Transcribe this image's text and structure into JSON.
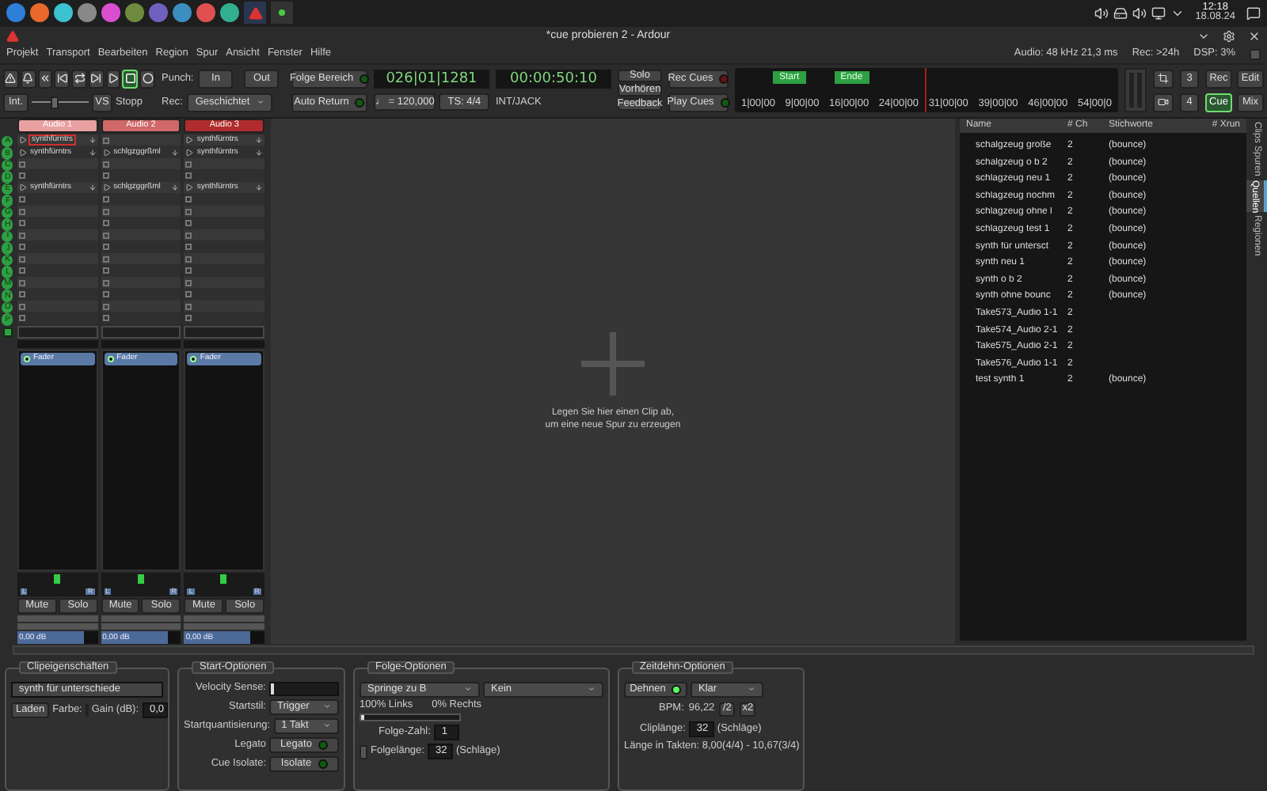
{
  "taskbar": {
    "time": "12:18",
    "date": "18.08.24"
  },
  "window": {
    "title": "*cue probieren 2 - Ardour"
  },
  "menu": [
    "Projekt",
    "Transport",
    "Bearbeiten",
    "Region",
    "Spur",
    "Ansicht",
    "Fenster",
    "Hilfe"
  ],
  "status": [
    "Audio: 48 kHz 21,3 ms",
    "Rec: >24h",
    "DSP: 3%"
  ],
  "transport": [
    {
      "kind": "panic",
      "on": false
    },
    {
      "kind": "metronome",
      "on": false
    },
    {
      "kind": "start",
      "on": false
    },
    {
      "kind": "prev",
      "on": false
    },
    {
      "kind": "loop",
      "on": false
    },
    {
      "kind": "end",
      "on": false
    },
    {
      "kind": "play",
      "on": false
    },
    {
      "kind": "stop",
      "on": true
    },
    {
      "kind": "record",
      "on": false
    }
  ],
  "shuttle": {
    "mode": "Int.",
    "level": 0.4,
    "vs": "VS",
    "state": "Stopp"
  },
  "punch": {
    "label": "Punch:",
    "in": "In",
    "out": "Out"
  },
  "rec": {
    "label": "Rec:",
    "mode": "Geschichtet"
  },
  "toggles": [
    {
      "label": "Folge Bereich",
      "on": false
    },
    {
      "label": "Auto Return",
      "on": false
    }
  ],
  "clock1": {
    "value": "026|01|1281",
    "tempo": "♩ = 120,000",
    "meter": "TS: 4/4"
  },
  "clock2": {
    "value": "00:00:50:10",
    "sync": "INT/JACK"
  },
  "monitor": [
    "Solo",
    "Vorhören",
    "Feedback"
  ],
  "cue_buttons": [
    {
      "label": "Rec Cues",
      "kind": "rec",
      "on": false
    },
    {
      "label": "Play Cues",
      "kind": "play",
      "on": false
    }
  ],
  "mini_timeline": {
    "markers": [
      "Start",
      "Ende"
    ],
    "ticks": [
      "1|00|00",
      "9|00|00",
      "16|00|00",
      "24|00|00",
      "31|00|00",
      "39|00|00",
      "46|00|00",
      "54|00|0"
    ]
  },
  "numbers": [
    "3",
    "4"
  ],
  "views": [
    {
      "label": "Rec",
      "selected": false
    },
    {
      "label": "Edit",
      "selected": false
    },
    {
      "label": "Cue",
      "selected": true
    },
    {
      "label": "Mix",
      "selected": false
    }
  ],
  "cues": [
    "A",
    "B",
    "C",
    "D",
    "E",
    "F",
    "G",
    "H",
    "I",
    "J",
    "K",
    "L",
    "M",
    "N",
    "O",
    "P"
  ],
  "tracks": [
    {
      "name": "Audio 1",
      "color": "#e8a0a0",
      "plugin": "Fader",
      "pan_l": "L",
      "pan_r": "R",
      "mute": "Mute",
      "solo": "Solo",
      "gain": "0,00 dB",
      "slots": [
        {
          "kind": "clip",
          "label": "synthfürntrs",
          "selected": true
        },
        {
          "kind": "clip",
          "label": "synthfürntrs",
          "selected": false
        },
        {
          "kind": "empty",
          "selected": false
        },
        {
          "kind": "empty",
          "selected": false
        },
        {
          "kind": "clip",
          "label": "synthfürntrs",
          "selected": false
        },
        {
          "kind": "empty",
          "selected": false
        },
        {
          "kind": "empty",
          "selected": false
        },
        {
          "kind": "empty",
          "selected": false
        },
        {
          "kind": "empty",
          "selected": false
        },
        {
          "kind": "empty",
          "selected": false
        },
        {
          "kind": "empty",
          "selected": false
        },
        {
          "kind": "empty",
          "selected": false
        },
        {
          "kind": "empty",
          "selected": false
        },
        {
          "kind": "empty",
          "selected": false
        },
        {
          "kind": "empty",
          "selected": false
        },
        {
          "kind": "empty",
          "selected": false
        }
      ]
    },
    {
      "name": "Audio 2",
      "color": "#d06868",
      "plugin": "Fader",
      "pan_l": "L",
      "pan_r": "R",
      "mute": "Mute",
      "solo": "Solo",
      "gain": "0,00 dB",
      "slots": [
        {
          "kind": "empty",
          "selected": false
        },
        {
          "kind": "clip",
          "label": "schlgzggrßml",
          "selected": false
        },
        {
          "kind": "empty",
          "selected": false
        },
        {
          "kind": "empty",
          "selected": false
        },
        {
          "kind": "clip",
          "label": "schlgzggrßml",
          "selected": false
        },
        {
          "kind": "empty",
          "selected": false
        },
        {
          "kind": "empty",
          "selected": false
        },
        {
          "kind": "empty",
          "selected": false
        },
        {
          "kind": "empty",
          "selected": false
        },
        {
          "kind": "empty",
          "selected": false
        },
        {
          "kind": "empty",
          "selected": false
        },
        {
          "kind": "empty",
          "selected": false
        },
        {
          "kind": "empty",
          "selected": false
        },
        {
          "kind": "empty",
          "selected": false
        },
        {
          "kind": "empty",
          "selected": false
        },
        {
          "kind": "empty",
          "selected": false
        }
      ]
    },
    {
      "name": "Audio 3",
      "color": "#b02c2c",
      "plugin": "Fader",
      "pan_l": "L",
      "pan_r": "R",
      "mute": "Mute",
      "solo": "Solo",
      "gain": "0,00 dB",
      "slots": [
        {
          "kind": "clip",
          "label": "synthfürntrs",
          "selected": false
        },
        {
          "kind": "clip",
          "label": "synthfürntrs",
          "selected": false
        },
        {
          "kind": "empty",
          "selected": false
        },
        {
          "kind": "empty",
          "selected": false
        },
        {
          "kind": "clip",
          "label": "synthfürntrs",
          "selected": false
        },
        {
          "kind": "empty",
          "selected": false
        },
        {
          "kind": "empty",
          "selected": false
        },
        {
          "kind": "empty",
          "selected": false
        },
        {
          "kind": "empty",
          "selected": false
        },
        {
          "kind": "empty",
          "selected": false
        },
        {
          "kind": "empty",
          "selected": false
        },
        {
          "kind": "empty",
          "selected": false
        },
        {
          "kind": "empty",
          "selected": false
        },
        {
          "kind": "empty",
          "selected": false
        },
        {
          "kind": "empty",
          "selected": false
        },
        {
          "kind": "empty",
          "selected": false
        }
      ]
    }
  ],
  "drop_hint": [
    "Legen Sie hier einen Clip ab,",
    "um eine neue Spur zu erzeugen"
  ],
  "sources": {
    "columns": [
      "Name",
      "# Ch",
      "Stichworte",
      "# Xrun"
    ],
    "rows": [
      {
        "name": "schalgzeug große",
        "ch": "2",
        "tags": "(bounce)"
      },
      {
        "name": "schalgzeug o b 2",
        "ch": "2",
        "tags": "(bounce)"
      },
      {
        "name": "schlagzeug neu 1",
        "ch": "2",
        "tags": "(bounce)"
      },
      {
        "name": "schlagzeug nochm",
        "ch": "2",
        "tags": "(bounce)"
      },
      {
        "name": "schlagzeug ohne l",
        "ch": "2",
        "tags": "(bounce)"
      },
      {
        "name": "schlagzeug test 1",
        "ch": "2",
        "tags": "(bounce)"
      },
      {
        "name": "synth für untersct",
        "ch": "2",
        "tags": "(bounce)"
      },
      {
        "name": "synth neu 1",
        "ch": "2",
        "tags": "(bounce)"
      },
      {
        "name": "synth o b 2",
        "ch": "2",
        "tags": "(bounce)"
      },
      {
        "name": "synth ohne bounc",
        "ch": "2",
        "tags": "(bounce)"
      },
      {
        "name": "Take573_Audio 1-1",
        "ch": "2"
      },
      {
        "name": "Take574_Audio 2-1",
        "ch": "2"
      },
      {
        "name": "Take575_Audio 2-1",
        "ch": "2"
      },
      {
        "name": "Take576_Audio 1-1",
        "ch": "2"
      },
      {
        "name": "test synth 1",
        "ch": "2",
        "tags": "(bounce)"
      }
    ]
  },
  "side_tabs": [
    {
      "label": "Clips",
      "selected": false
    },
    {
      "label": "Spuren",
      "selected": false
    },
    {
      "label": "Quellen",
      "selected": true
    },
    {
      "label": "Regionen",
      "selected": false
    }
  ],
  "clip_props": {
    "title": "Clipeigenschaften",
    "name": "synth für unterschiede",
    "load": "Laden",
    "color_label": "Farbe:",
    "gain_label": "Gain (dB):",
    "gain": "0,0"
  },
  "start_options": {
    "title": "Start-Optionen",
    "velocity_label": "Velocity Sense:",
    "velocity": {
      "level": 0
    },
    "rows": [
      {
        "label": "Startstil:",
        "value": "Trigger",
        "kind": "dropdown"
      },
      {
        "label": "Startquantisierung:",
        "value": "1 Takt",
        "kind": "dropdown"
      },
      {
        "label": "Legato",
        "value": "Legato",
        "kind": "toggle",
        "on": false
      },
      {
        "label": "Cue Isolate:",
        "value": "Isolate",
        "kind": "toggle",
        "on": false
      }
    ]
  },
  "follow_options": {
    "title": "Folge-Optionen",
    "action_a": "Springe zu B",
    "action_b": "Kein",
    "left": "100% Links",
    "right": "0% Rechts",
    "level": 0,
    "count_label": "Folge-Zahl:",
    "count": "1",
    "length_checked": false,
    "length_label": "Folgelänge:",
    "length": "32",
    "unit": "(Schläge)"
  },
  "stretch_options": {
    "title": "Zeitdehn-Optionen",
    "stretch": "Dehnen",
    "stretch_on": true,
    "mode": "Klar",
    "bpm_label": "BPM:",
    "bpm": "96,22",
    "half": "/2",
    "double": "x2",
    "len_label": "Cliplänge:",
    "len": "32",
    "unit": "(Schläge)",
    "bars": "Länge in Takten: 8,00(4/4) - 10,67(3/4)"
  }
}
